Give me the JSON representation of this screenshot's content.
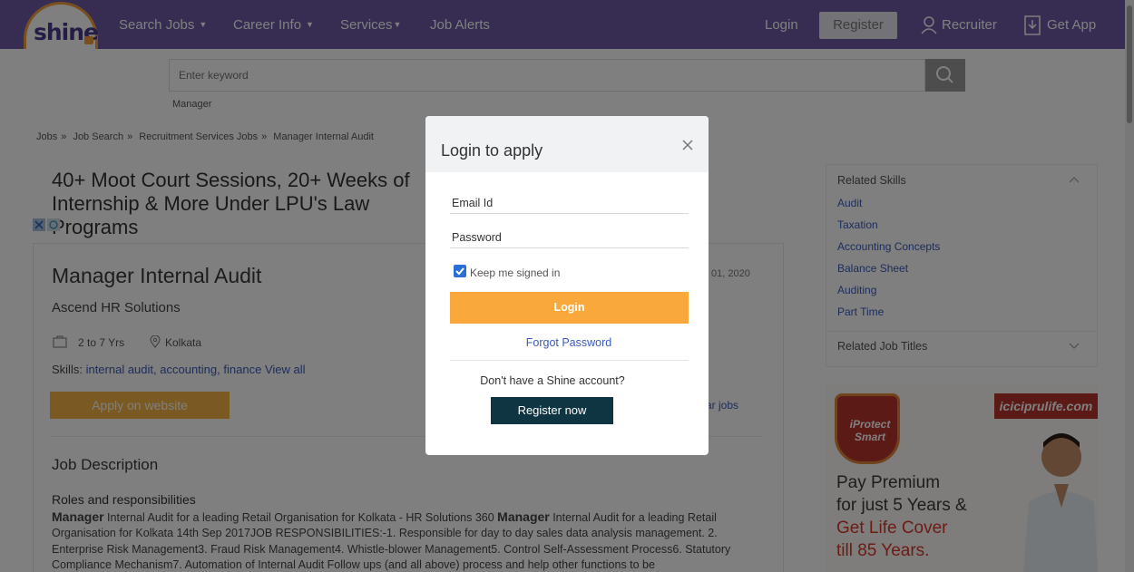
{
  "nav": {
    "logo": "shine",
    "items": [
      "Search Jobs",
      "Career Info",
      "Services",
      "Job Alerts"
    ],
    "login": "Login",
    "register": "Register",
    "recruiter": "Recruiter",
    "get_app": "Get App"
  },
  "search": {
    "placeholder": "Enter keyword",
    "tag": "Manager"
  },
  "breadcrumb": [
    "Jobs",
    "Job Search",
    "Recruitment Services Jobs",
    "Manager Internal Audit"
  ],
  "ad_banner": {
    "title": "40+ Moot Court Sessions, 20+ Weeks of Internship & More Under LPU's Law Programs"
  },
  "job": {
    "title": "Manager Internal Audit",
    "date": "01, 2020",
    "company": "Ascend HR Solutions",
    "experience": "2 to 7 Yrs",
    "location": "Kolkata",
    "skills_label": "Skills:",
    "skills": [
      "internal audit,",
      "accounting,",
      "finance"
    ],
    "view_all": "View all",
    "apply_label": "Apply on website",
    "similar": "ar jobs",
    "jd_heading": "Job Description",
    "roles_heading": "Roles and responsibilities",
    "jd_part1": "Manager",
    "jd_part2": " Internal Audit for a leading Retail Organisation for Kolkata - HR Solutions 360 ",
    "jd_part3": "Manager",
    "jd_part4": " Internal Audit for a leading Retail Organisation for Kolkata 14th Sep 2017JOB RESPONSIBILITIES:-1. Responsible for day to day sales data analysis management. 2. Enterprise Risk Management3. Fraud Risk Management4. Whistle-blower Management5. Control Self-Assessment Process6. Statutory Compliance Mechanism7. Automation of Internal Audit Follow ups (and all above) process and help other functions to be"
  },
  "sidebar": {
    "related_skills": "Related Skills",
    "skills": [
      "Audit",
      "Taxation",
      "Accounting Concepts",
      "Balance Sheet",
      "Auditing",
      "Part Time"
    ],
    "related_titles": "Related Job Titles"
  },
  "right_ad": {
    "badge": "iProtect Smart",
    "site": "iciciprulife.com",
    "line1": "Pay Premium",
    "line2": "for just 5 Years &",
    "line3": "Get Life Cover",
    "line4": "till 85 Years."
  },
  "modal": {
    "title": "Login to apply",
    "email_label": "Email Id",
    "password_label": "Password",
    "remember_label": "Keep me signed in",
    "login_button": "Login",
    "forgot": "Forgot Password",
    "no_account": "Don't have a Shine account?",
    "register_button": "Register now"
  }
}
